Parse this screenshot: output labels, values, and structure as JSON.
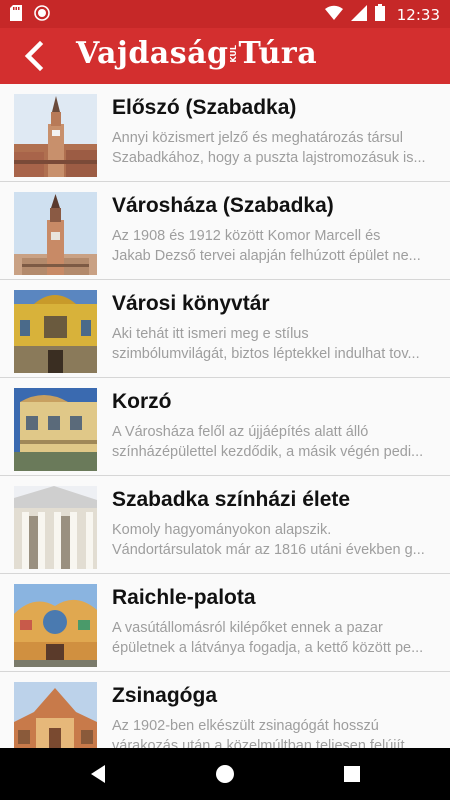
{
  "status": {
    "time": "12:33",
    "icons": [
      "sd-card-icon",
      "record-icon",
      "wifi-icon",
      "signal-icon",
      "battery-icon"
    ]
  },
  "appbar": {
    "logo_left": "Vajdaság",
    "logo_mid": "KUL",
    "logo_right": "Túra"
  },
  "colors": {
    "status_bar": "#c62828",
    "app_bar": "#d32f2f"
  },
  "items": [
    {
      "title": "Előszó (Szabadka)",
      "desc1": "Annyi közismert jelző és meghatározás társul",
      "desc2": "Szabadkához, hogy a puszta lajstromozásuk is..."
    },
    {
      "title": "Városháza (Szabadka)",
      "desc1": "Az 1908 és 1912 között Komor Marcell és",
      "desc2": "Jakab Dezső tervei alapján felhúzott épület ne..."
    },
    {
      "title": "Városi könyvtár",
      "desc1": "Aki tehát itt ismeri meg e stílus",
      "desc2": "szimbólumvilágát, biztos léptekkel indulhat tov..."
    },
    {
      "title": "Korzó",
      "desc1": "A Városháza felől az újjáépítés alatt álló",
      "desc2": "színházépülettel kezdődik, a másik végén pedi..."
    },
    {
      "title": "Szabadka színházi élete",
      "desc1": "Komoly hagyományokon alapszik.",
      "desc2": "Vándortársulatok már az 1816 utáni években g..."
    },
    {
      "title": "Raichle-palota",
      "desc1": "A vasútállomásról kilépőket ennek a pazar",
      "desc2": "épületnek a látványa fogadja, a kettő között pe..."
    },
    {
      "title": "Zsinagóga",
      "desc1": "Az 1902-ben elkészült zsinagógát hosszú",
      "desc2": "várakozás után a közelmúltban teljesen felújít..."
    }
  ]
}
